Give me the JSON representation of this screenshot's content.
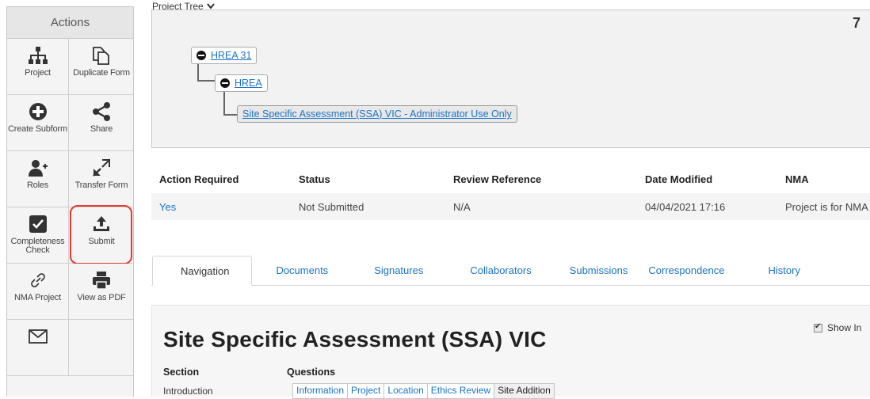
{
  "actions": {
    "header": "Actions",
    "items": [
      {
        "label": "Project",
        "icon": "sitemap-icon"
      },
      {
        "label": "Duplicate Form",
        "icon": "duplicate-icon"
      },
      {
        "label": "Create Subform",
        "icon": "plus-circle-icon"
      },
      {
        "label": "Share",
        "icon": "share-icon"
      },
      {
        "label": "Roles",
        "icon": "user-plus-icon"
      },
      {
        "label": "Transfer Form",
        "icon": "transfer-icon"
      },
      {
        "label": "Completeness Check",
        "icon": "checkbox-icon"
      },
      {
        "label": "Submit",
        "icon": "upload-icon"
      },
      {
        "label": "NMA Project",
        "icon": "link-icon"
      },
      {
        "label": "View as PDF",
        "icon": "printer-icon"
      },
      {
        "label": "",
        "icon": "envelope-icon"
      },
      {
        "label": "",
        "icon": ""
      }
    ]
  },
  "project_tree": {
    "label": "Project Tree",
    "corner": "7",
    "nodes": [
      "HREA 31",
      "HREA",
      "Site Specific Assessment (SSA) VIC - Administrator Use Only"
    ]
  },
  "summary": {
    "headers": [
      "Action Required",
      "Status",
      "Review Reference",
      "Date Modified",
      "NMA"
    ],
    "values": [
      "Yes",
      "Not Submitted",
      "N/A",
      "04/04/2021 17:16",
      "Project is for NMA"
    ]
  },
  "tabs": [
    "Navigation",
    "Documents",
    "Signatures",
    "Collaborators",
    "Submissions",
    "Correspondence",
    "History"
  ],
  "content": {
    "show_label": "Show In",
    "title": "Site Specific Assessment (SSA) VIC",
    "section_header": "Section",
    "questions_header": "Questions",
    "section_row": "Introduction",
    "question_tabs": [
      "Information",
      "Project",
      "Location",
      "Ethics Review",
      "Site Addition"
    ]
  },
  "colors": {
    "link": "#1a73c8",
    "highlight": "#e53935"
  }
}
